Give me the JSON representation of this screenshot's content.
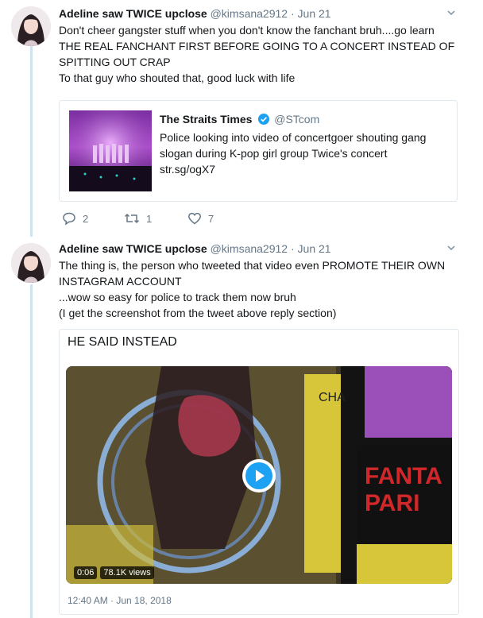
{
  "tweets": [
    {
      "author_name": "Adeline saw TWICE upclose",
      "handle": "@kimsana2912",
      "separator": "·",
      "date": "Jun 21",
      "body_lines": [
        "Don't cheer gangster stuff when you don't know the fanchant bruh....go learn",
        "THE REAL FANCHANT FIRST BEFORE GOING TO A CONCERT INSTEAD OF",
        "SPITTING OUT CRAP",
        "To that guy who shouted that, good luck with life"
      ],
      "quote": {
        "source_name": "The Straits Times",
        "source_handle": "@STcom",
        "text_lines": [
          "Police looking into video of concertgoer shouting gang",
          "slogan during K-pop girl group Twice's concert",
          "str.sg/ogX7"
        ]
      },
      "actions": {
        "replies": "2",
        "retweets": "1",
        "likes": "7"
      }
    },
    {
      "author_name": "Adeline saw TWICE upclose",
      "handle": "@kimsana2912",
      "separator": "·",
      "date": "Jun 21",
      "body_lines": [
        "The thing is, the person who tweeted that video even PROMOTE THEIR OWN",
        "INSTAGRAM ACCOUNT",
        "...wow so easy for police to track them now bruh",
        "(I get the screenshot from the tweet above reply section)"
      ],
      "embed": {
        "title": "HE SAID INSTEAD",
        "video_time": "0:06",
        "video_views": "78.1K views",
        "sign_lines": [
          "FANTA",
          "PARI"
        ],
        "banner_text": "CHA",
        "timestamp": "12:40 AM · Jun 18, 2018"
      }
    }
  ],
  "colors": {
    "text_primary": "#14171a",
    "text_secondary": "#657786",
    "thread_line": "#cfe3ef",
    "verified_blue": "#1da1f2",
    "play_blue": "#1da1f2",
    "sign_red": "#d0282a",
    "border": "#e1e8ed"
  },
  "icons": {
    "reply": "reply-bubble-icon",
    "retweet": "retweet-icon",
    "like": "heart-icon",
    "caret": "chevron-down-icon",
    "verified": "verified-badge-icon",
    "play": "play-icon"
  }
}
